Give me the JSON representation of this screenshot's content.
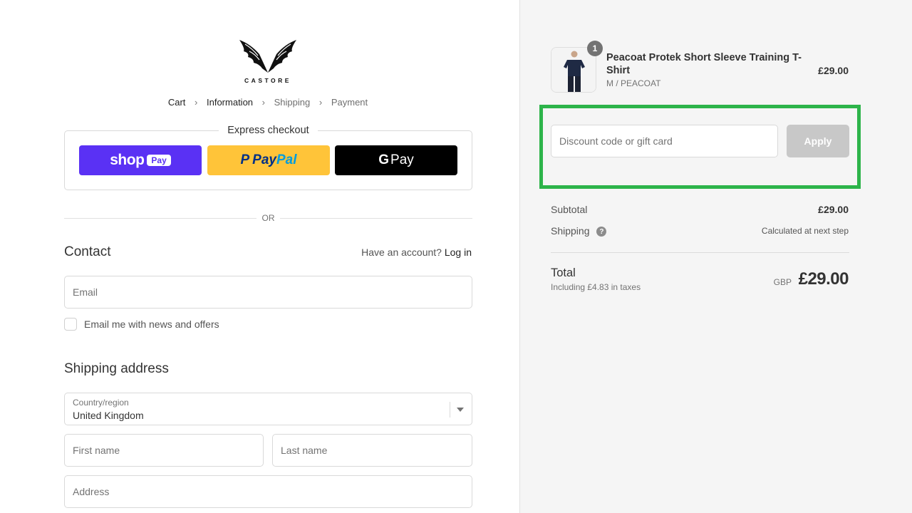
{
  "brand": {
    "name": "CASTORE"
  },
  "breadcrumb": {
    "items": [
      "Cart",
      "Information",
      "Shipping",
      "Payment"
    ]
  },
  "express": {
    "title": "Express checkout",
    "shop_word": "shop",
    "shop_pay": "Pay",
    "paypal_a": "Pay",
    "paypal_b": "Pal",
    "gpay_g": "G",
    "gpay_pay": "Pay"
  },
  "divider_or": "OR",
  "contact": {
    "heading": "Contact",
    "account_prompt": "Have an account?",
    "login": "Log in",
    "email_placeholder": "Email",
    "newsletter_label": "Email me with news and offers"
  },
  "shipping_address": {
    "heading": "Shipping address",
    "country_label": "Country/region",
    "country_value": "United Kingdom",
    "first_name_placeholder": "First name",
    "last_name_placeholder": "Last name",
    "address_placeholder": "Address"
  },
  "order": {
    "item": {
      "quantity": "1",
      "name": "Peacoat Protek Short Sleeve Training T-Shirt",
      "variant": "M / PEACOAT",
      "price": "£29.00"
    },
    "discount_placeholder": "Discount code or gift card",
    "apply_label": "Apply",
    "subtotal_label": "Subtotal",
    "subtotal_value": "£29.00",
    "shipping_label": "Shipping",
    "shipping_value": "Calculated at next step",
    "help_glyph": "?",
    "total_label": "Total",
    "taxes_note": "Including £4.83 in taxes",
    "currency": "GBP",
    "total_value": "£29.00"
  },
  "colors": {
    "shop_pay": "#5a31f4",
    "paypal": "#ffc439",
    "gpay": "#000000",
    "highlight": "#2db44a",
    "apply_disabled": "#c8c8c8"
  }
}
